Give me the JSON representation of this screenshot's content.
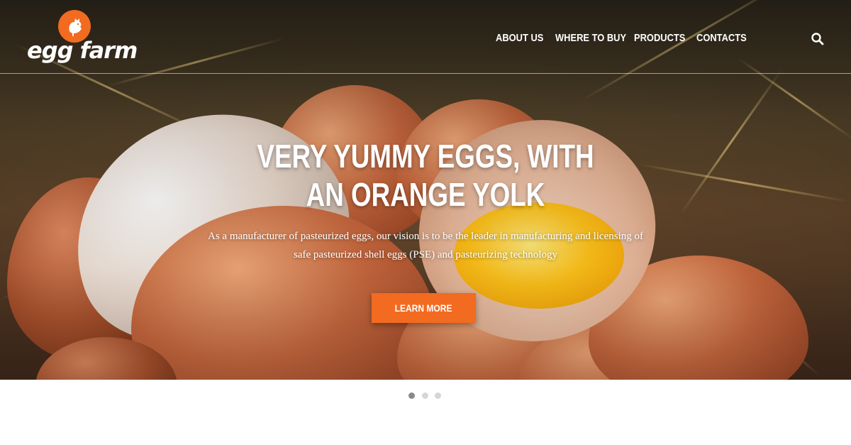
{
  "brand": {
    "name": "egg farm",
    "accent_color": "#f26b21",
    "logo_icon": "rooster-icon"
  },
  "nav": {
    "items": [
      {
        "label": "ABOUT US"
      },
      {
        "label": "WHERE TO BUY"
      },
      {
        "label": "PRODUCTS"
      },
      {
        "label": "CONTACTS"
      }
    ],
    "search_icon": "search-icon"
  },
  "hero": {
    "headline": "VERY YUMMY EGGS, WITH AN ORANGE YOLK",
    "description": "As a manufacturer of pasteurized eggs, our vision is to be the leader in manufacturing and licensing of safe pasteurized shell eggs (PSE) and pasteurizing technology",
    "cta_label": "LEARN MORE"
  },
  "carousel": {
    "slide_count": 3,
    "active_index": 0
  }
}
